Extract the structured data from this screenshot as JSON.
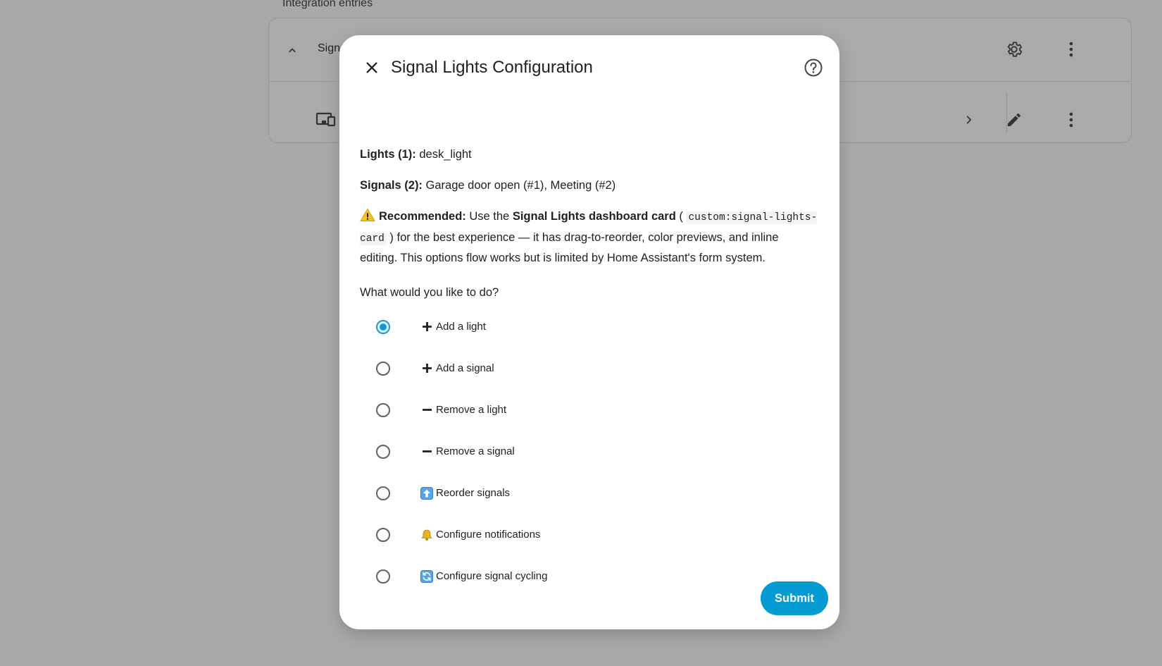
{
  "background": {
    "section_title": "Integration entries",
    "entry_title": "Sign"
  },
  "dialog": {
    "title": "Signal Lights Configuration",
    "lights_label": "Lights (1):",
    "lights_value": "desk_light",
    "signals_label": "Signals (2):",
    "signals_value": "Garage door open (#1), Meeting (#2)",
    "recommend_label": "Recommended:",
    "recommend_pre": "Use the",
    "recommend_card": "Signal Lights dashboard card",
    "recommend_open": "(",
    "recommend_code": "custom:signal-lights-card",
    "recommend_rest": ") for the best experience — it has drag-to-reorder, color previews, and inline editing. This options flow works but is limited by Home Assistant's form system.",
    "question": "What would you like to do?",
    "options": [
      {
        "label": "Add a light",
        "icon": "plus-icon",
        "checked": true
      },
      {
        "label": "Add a signal",
        "icon": "plus-icon",
        "checked": false
      },
      {
        "label": "Remove a light",
        "icon": "minus-icon",
        "checked": false
      },
      {
        "label": "Remove a signal",
        "icon": "minus-icon",
        "checked": false
      },
      {
        "label": "Reorder signals",
        "icon": "up-arrow-icon",
        "checked": false
      },
      {
        "label": "Configure notifications",
        "icon": "bell-icon",
        "checked": false
      },
      {
        "label": "Configure signal cycling",
        "icon": "cycle-icon",
        "checked": false
      }
    ],
    "submit_label": "Submit"
  },
  "colors": {
    "accent": "#039be5",
    "button": "#039bd1",
    "overlay": "#a9a9a9"
  }
}
